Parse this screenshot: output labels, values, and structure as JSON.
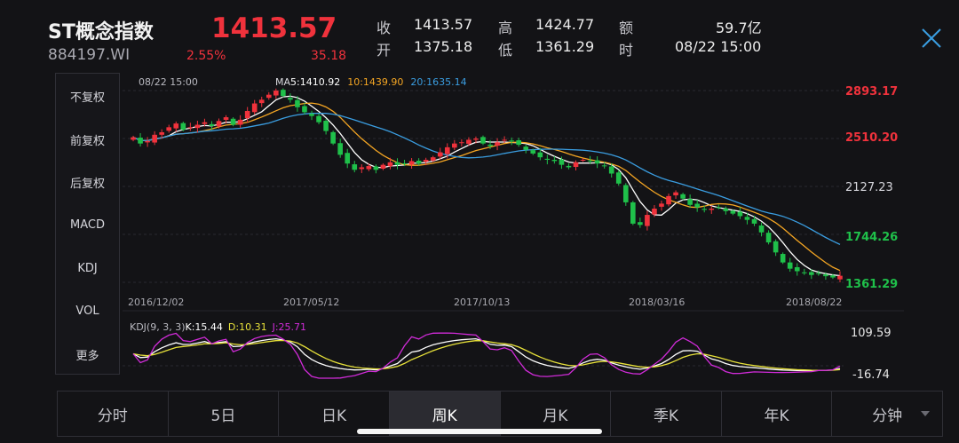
{
  "header": {
    "name": "ST概念指数",
    "code": "884197.WI",
    "price": "1413.57",
    "change_pct": "2.55%",
    "change_abs": "35.18",
    "quotes": [
      {
        "label": "收",
        "value": "1413.57"
      },
      {
        "label": "开",
        "value": "1375.18"
      },
      {
        "label": "高",
        "value": "1424.77"
      },
      {
        "label": "低",
        "value": "1361.29"
      },
      {
        "label": "额",
        "value": "59.7亿"
      },
      {
        "label": "时",
        "value": "08/22 15:00"
      }
    ]
  },
  "sidebar": {
    "items": [
      {
        "label": "不复权",
        "active": true
      },
      {
        "label": "前复权",
        "active": false
      },
      {
        "label": "后复权",
        "active": false
      },
      {
        "label": "MACD",
        "active": false
      },
      {
        "label": "KDJ",
        "active": true
      },
      {
        "label": "VOL",
        "active": false
      },
      {
        "label": "更多",
        "active": false
      }
    ]
  },
  "tabs": [
    {
      "label": "分时",
      "active": false
    },
    {
      "label": "5日",
      "active": false
    },
    {
      "label": "日K",
      "active": false
    },
    {
      "label": "周K",
      "active": true
    },
    {
      "label": "月K",
      "active": false
    },
    {
      "label": "季K",
      "active": false
    },
    {
      "label": "年K",
      "active": false
    },
    {
      "label": "分钟",
      "active": false
    }
  ],
  "colors": {
    "up": "#f0323c",
    "down": "#1fc04a",
    "ma5": "#ffffff",
    "ma10": "#f5a623",
    "ma20": "#3a9de0",
    "kdj_k": "#ffffff",
    "kdj_d": "#e8e23a",
    "kdj_j": "#d12bd9",
    "accent": "#3aa0ff"
  },
  "chart_data": {
    "type": "candlestick",
    "time_label": "08/22 15:00",
    "ma_legend": {
      "prefix": "MA",
      "ma5": "5:1410.92",
      "ma10": "10:1439.90",
      "ma20": "20:1635.14"
    },
    "price_ticks": [
      "2893.17",
      "2510.20",
      "2127.23",
      "1744.26",
      "1361.29"
    ],
    "price_range": [
      1361.29,
      2893.17
    ],
    "date_labels": [
      "2016/12/02",
      "2017/05/12",
      "2017/10/13",
      "2018/03/16",
      "2018/08/22"
    ],
    "close_series": [
      2520,
      2470,
      2490,
      2540,
      2560,
      2600,
      2630,
      2580,
      2600,
      2620,
      2640,
      2610,
      2650,
      2680,
      2620,
      2660,
      2730,
      2790,
      2820,
      2860,
      2893,
      2850,
      2820,
      2760,
      2720,
      2690,
      2640,
      2570,
      2470,
      2380,
      2310,
      2260,
      2280,
      2290,
      2260,
      2300,
      2320,
      2300,
      2310,
      2330,
      2310,
      2340,
      2360,
      2400,
      2440,
      2470,
      2480,
      2500,
      2510,
      2470,
      2450,
      2480,
      2500,
      2490,
      2460,
      2420,
      2390,
      2360,
      2340,
      2330,
      2300,
      2280,
      2320,
      2340,
      2330,
      2310,
      2290,
      2230,
      2150,
      2000,
      1830,
      1820,
      1900,
      1950,
      1990,
      2050,
      2080,
      2030,
      1980,
      1960,
      1940,
      1950,
      1960,
      1930,
      1910,
      1890,
      1860,
      1830,
      1760,
      1680,
      1600,
      1520,
      1470,
      1450,
      1440,
      1420,
      1430,
      1410,
      1400,
      1413.57
    ],
    "kdj_ticks": [
      "109.59",
      "-16.74"
    ],
    "kdj_legend": {
      "name": "KDJ(9, 3, 3)",
      "k": "K:15.44",
      "d": "D:10.31",
      "j": "J:25.71"
    }
  }
}
